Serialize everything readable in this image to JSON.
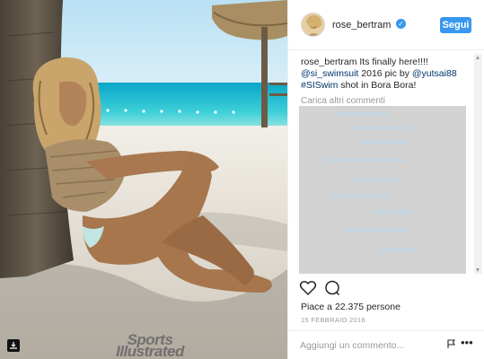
{
  "post": {
    "username": "rose_bertram",
    "follow_label": "Segui",
    "caption_user": "rose_bertram",
    "caption_line1": " Its finally here!!!!",
    "caption_mention1": "@si_swimsuit",
    "caption_mid": " 2016 pic by ",
    "caption_mention2": "@yutsai88",
    "caption_hashtag": "#SISwim",
    "caption_end": " shot in Bora Bora!",
    "load_more": "Carica altri commenti",
    "likes": "Piace a 22.375 persone",
    "date": "15 FEBBRAIO 2016",
    "comment_placeholder": "Aggiungi un commento...",
    "more": "•••"
  },
  "photo": {
    "watermark_line1": "Sports",
    "watermark_line2": "Illustrated"
  },
  "colors": {
    "accent": "#3897f0",
    "link": "#003569",
    "muted": "#999999"
  },
  "icons": [
    "heart-icon",
    "comment-icon",
    "flag-icon",
    "more-icon",
    "verified-icon",
    "instagram-icon"
  ]
}
